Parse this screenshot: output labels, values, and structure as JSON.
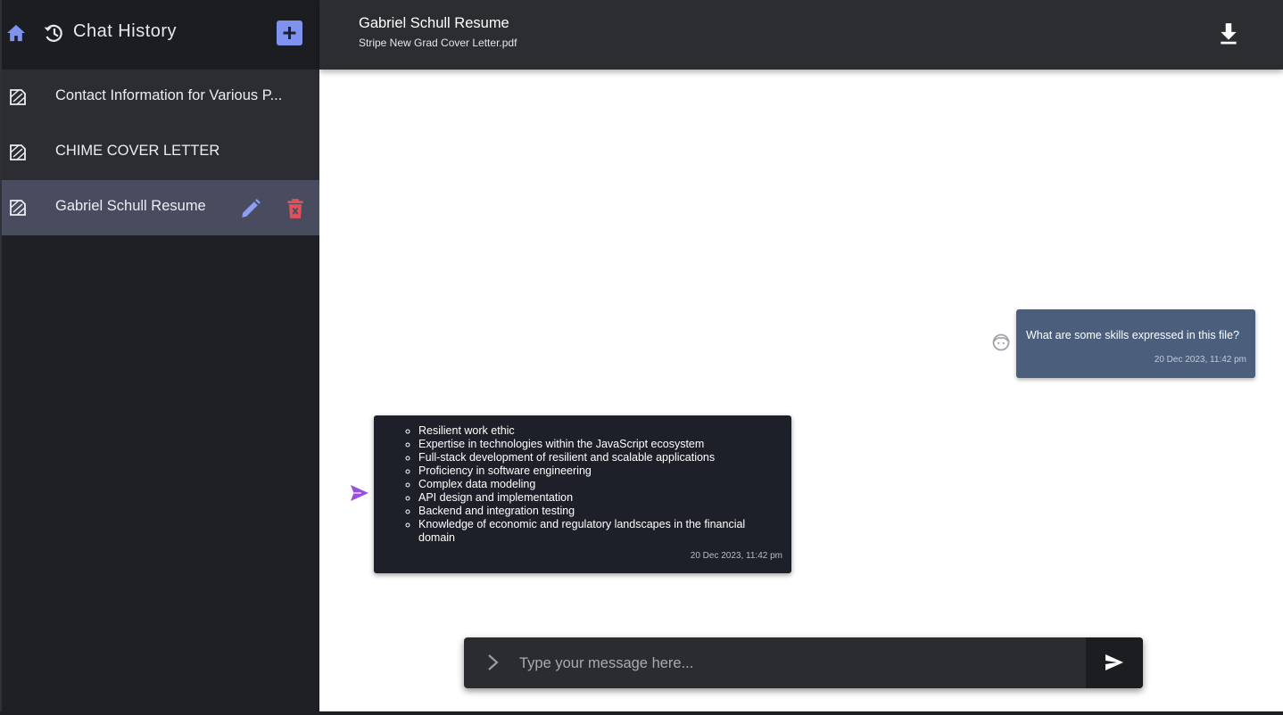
{
  "sidebar": {
    "title": "Chat History",
    "items": [
      {
        "label": "Contact Information for Various P..."
      },
      {
        "label": "CHIME COVER LETTER"
      },
      {
        "label": "Gabriel Schull Resume"
      }
    ]
  },
  "header": {
    "title": "Gabriel Schull Resume",
    "subtitle": "Stripe New Grad Cover Letter.pdf"
  },
  "messages": {
    "user": {
      "text": "What are some skills expressed in this file?",
      "time": "20 Dec 2023, 11:42 pm"
    },
    "bot": {
      "items": [
        "Resilient work ethic",
        "Expertise in technologies within the JavaScript ecosystem",
        "Full-stack development of resilient and scalable applications",
        "Proficiency in software engineering",
        "Complex data modeling",
        "API design and implementation",
        "Backend and integration testing",
        "Knowledge of economic and regulatory landscapes in the financial domain"
      ],
      "time": "20 Dec 2023, 11:42 pm"
    }
  },
  "composer": {
    "placeholder": "Type your message here..."
  },
  "colors": {
    "accent": "#7f92f0",
    "selected_item": "#484c5e",
    "user_bubble": "#4b5f7d",
    "bot_bubble": "#1e2029",
    "delete": "#e0525a",
    "bot_icon": "#9b4de0"
  },
  "icons": {
    "home": "home-icon",
    "history": "history-icon",
    "add": "plus-icon",
    "document": "document-icon",
    "edit": "pencil-icon",
    "delete": "trash-icon",
    "download": "download-icon",
    "user_avatar": "face-icon",
    "bot": "paper-plane-icon",
    "chevron": "chevron-right-icon",
    "send": "send-icon"
  }
}
